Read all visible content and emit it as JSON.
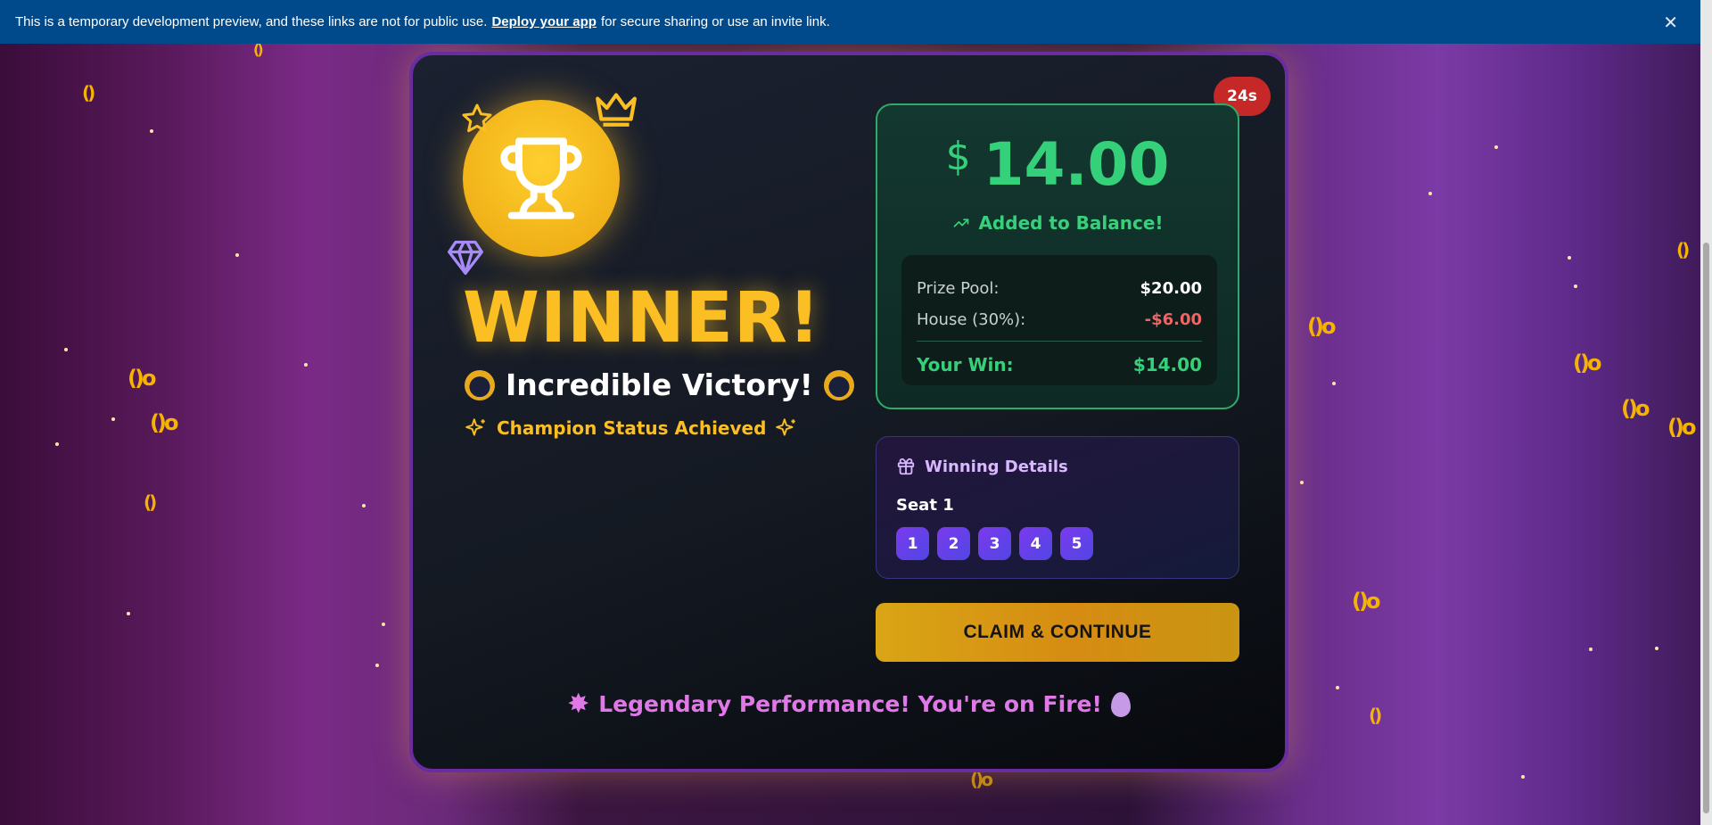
{
  "banner": {
    "text_before": "This is a temporary development preview, and these links are not for public use.",
    "link": "Deploy your app",
    "text_after": "for secure sharing or use an invite link.",
    "close_icon": "close-icon"
  },
  "timer": "24s",
  "hero": {
    "title": "WINNER!",
    "subtitle": "Incredible Victory!",
    "status": "Champion Status Achieved",
    "icons": [
      "trophy-icon",
      "crown-icon",
      "star-icon",
      "gem-icon",
      "sparkles-icon"
    ]
  },
  "prize": {
    "currency": "$",
    "amount": "14.00",
    "added": "Added to Balance!",
    "pool_label": "Prize Pool:",
    "pool_value": "$20.00",
    "house_label": "House (30%):",
    "house_value": "-$6.00",
    "win_label": "Your Win:",
    "win_value": "$14.00",
    "colors": {
      "accent": "#34d17a",
      "negative": "#f26464"
    }
  },
  "details": {
    "title": "Winning Details",
    "seat": "Seat 1",
    "numbers": [
      "1",
      "2",
      "3",
      "4",
      "5"
    ]
  },
  "claim_button": "CLAIM & CONTINUE",
  "footer_message": "Legendary Performance! You're on Fire!"
}
